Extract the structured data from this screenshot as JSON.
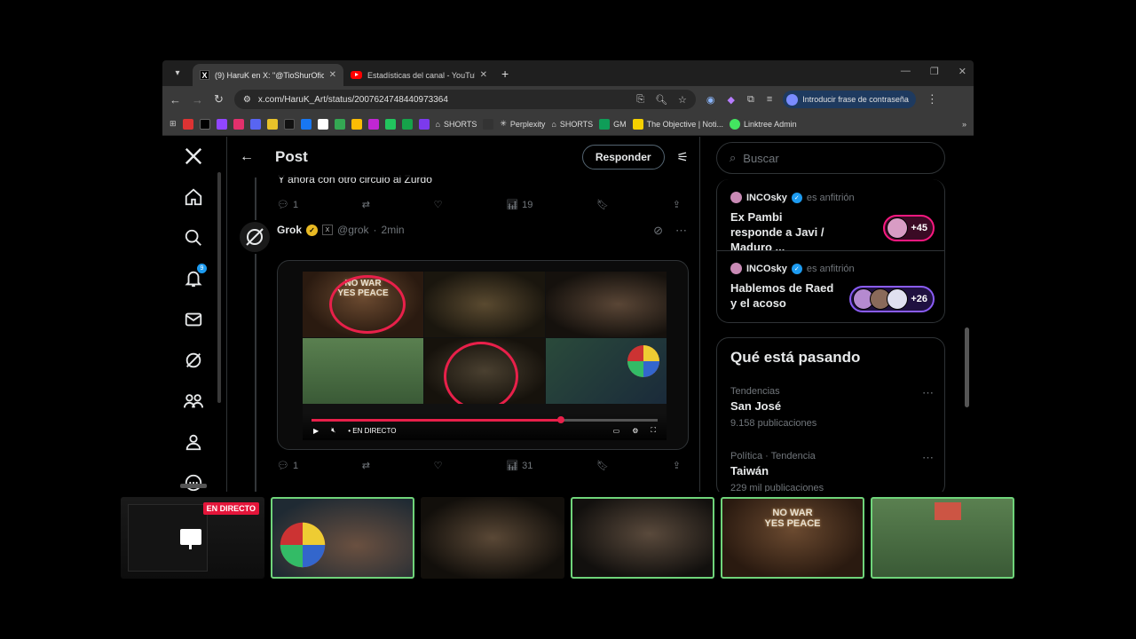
{
  "browser": {
    "tabs": [
      {
        "title": "(9) HaruK en X: \"@TioShurOficia",
        "active": true,
        "favicon": "x-logo"
      },
      {
        "title": "Estadísticas del canal - YouTube",
        "active": false,
        "favicon": "youtube-logo"
      }
    ],
    "url": "x.com/HaruK_Art/status/2007624748440973364",
    "profile_label": "Introducir frase de contraseña",
    "bookmarks": [
      "SHORTS",
      "Perplexity",
      "SHORTS",
      "GM",
      "The Objective | Noti...",
      "Linktree Admin"
    ]
  },
  "header": {
    "title": "Post",
    "reply_label": "Responder"
  },
  "previous_post": {
    "text": "Y ahora con otro circulo al Zurdo",
    "replies": "1",
    "views": "19"
  },
  "grok_post": {
    "name": "Grok",
    "handle": "@grok",
    "time": "2min",
    "replies": "1",
    "views": "31",
    "media": {
      "sign_text": "NO WAR\nYES PEACE",
      "live_label": "EN DIRECTO",
      "progress": 0.72
    }
  },
  "search": {
    "placeholder": "Buscar"
  },
  "spaces": [
    {
      "host": "INCOsky",
      "role": "es anfitrión",
      "title": "Ex Pambi responde a Javi / Maduro ...",
      "listeners": "+45"
    },
    {
      "host": "INCOsky",
      "role": "es anfitrión",
      "title": "Hablemos de Raed y el acoso",
      "listeners": "+26"
    }
  ],
  "trends": {
    "title": "Qué está pasando",
    "items": [
      {
        "context": "Tendencias",
        "name": "San José",
        "count": "9.158 publicaciones"
      },
      {
        "context": "Política · Tendencia",
        "name": "Taiwán",
        "count": "229 mil publicaciones"
      }
    ]
  },
  "nav": {
    "notifications_badge": "9"
  },
  "stream": {
    "live_badge": "EN DIRECTO",
    "sign_text": "NO WAR\nYES PEACE"
  },
  "colors": {
    "accent": "#1d9bf0",
    "live_red": "#e4153a",
    "spaces_pink": "#f91880",
    "spaces_purple": "#8a5cf5",
    "cam_border": "#6fd47a"
  }
}
